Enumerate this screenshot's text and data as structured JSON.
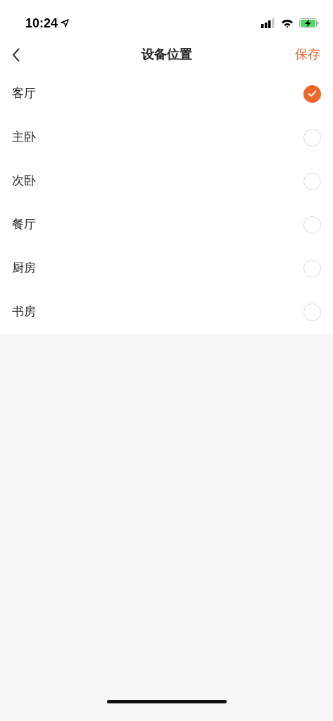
{
  "status_bar": {
    "time": "10:24"
  },
  "nav": {
    "title": "设备位置",
    "action": "保存"
  },
  "rooms": [
    {
      "label": "客厅",
      "selected": true
    },
    {
      "label": "主卧",
      "selected": false
    },
    {
      "label": "次卧",
      "selected": false
    },
    {
      "label": "餐厅",
      "selected": false
    },
    {
      "label": "厨房",
      "selected": false
    },
    {
      "label": "书房",
      "selected": false
    }
  ]
}
